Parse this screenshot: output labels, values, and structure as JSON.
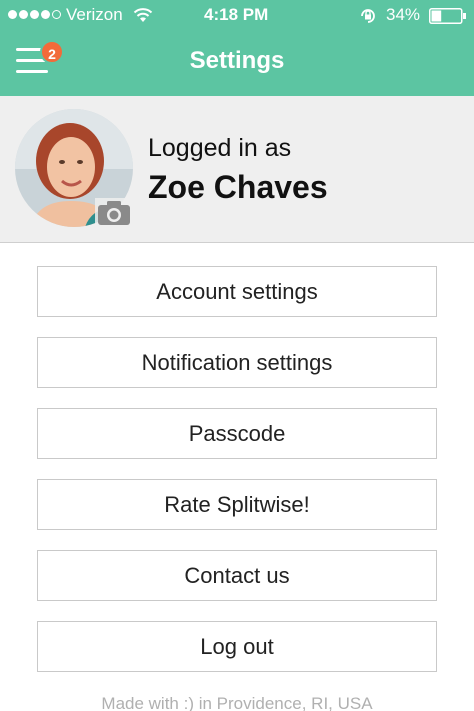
{
  "status_bar": {
    "carrier": "Verizon",
    "time": "4:18 PM",
    "battery_percent": "34%",
    "battery_level": 0.34,
    "signal_bars_filled": 4,
    "signal_bars_total": 5
  },
  "header": {
    "title": "Settings",
    "badge_count": "2",
    "color": "#5cc5a2"
  },
  "profile": {
    "logged_label": "Logged in as",
    "name": "Zoe Chaves"
  },
  "menu": {
    "items": [
      {
        "label": "Account settings"
      },
      {
        "label": "Notification settings"
      },
      {
        "label": "Passcode"
      },
      {
        "label": "Rate Splitwise!"
      },
      {
        "label": "Contact us"
      },
      {
        "label": "Log out"
      }
    ]
  },
  "footer": {
    "text": "Made with :) in Providence, RI, USA"
  }
}
